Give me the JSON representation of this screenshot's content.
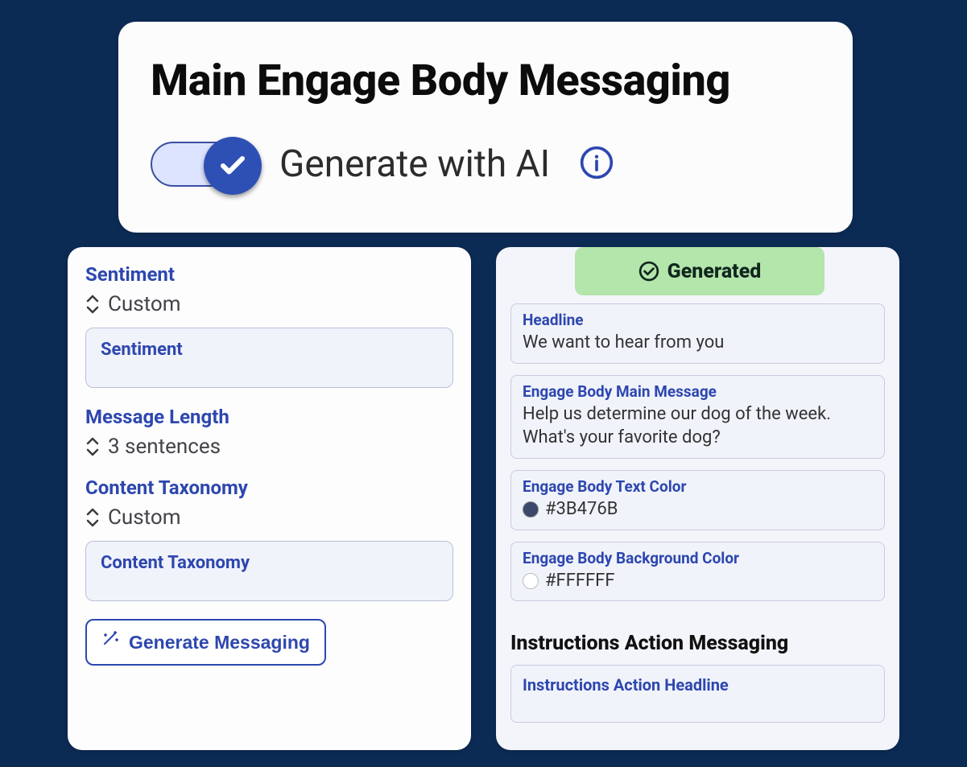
{
  "header": {
    "title": "Main Engage Body Messaging",
    "toggle_label": "Generate with AI"
  },
  "left": {
    "sentiment_label": "Sentiment",
    "sentiment_value": "Custom",
    "sentiment_placeholder": "Sentiment",
    "length_label": "Message Length",
    "length_value": "3 sentences",
    "taxonomy_label": "Content Taxonomy",
    "taxonomy_value": "Custom",
    "taxonomy_placeholder": "Content Taxonomy",
    "generate_label": "Generate Messaging"
  },
  "right": {
    "generated_label": "Generated",
    "headline_label": "Headline",
    "headline_value": "We want to hear from you",
    "main_msg_label": "Engage Body Main Message",
    "main_msg_value": "Help us determine our dog of the week. What's your favorite dog?",
    "text_color_label": "Engage Body Text Color",
    "text_color_value": "#3B476B",
    "bg_color_label": "Engage Body Background Color",
    "bg_color_value": "#FFFFFF",
    "instructions_title": "Instructions Action Messaging",
    "instructions_placeholder": "Instructions Action Headline"
  },
  "colors": {
    "text_color_swatch": "#3B476B",
    "bg_color_swatch": "#FFFFFF"
  }
}
